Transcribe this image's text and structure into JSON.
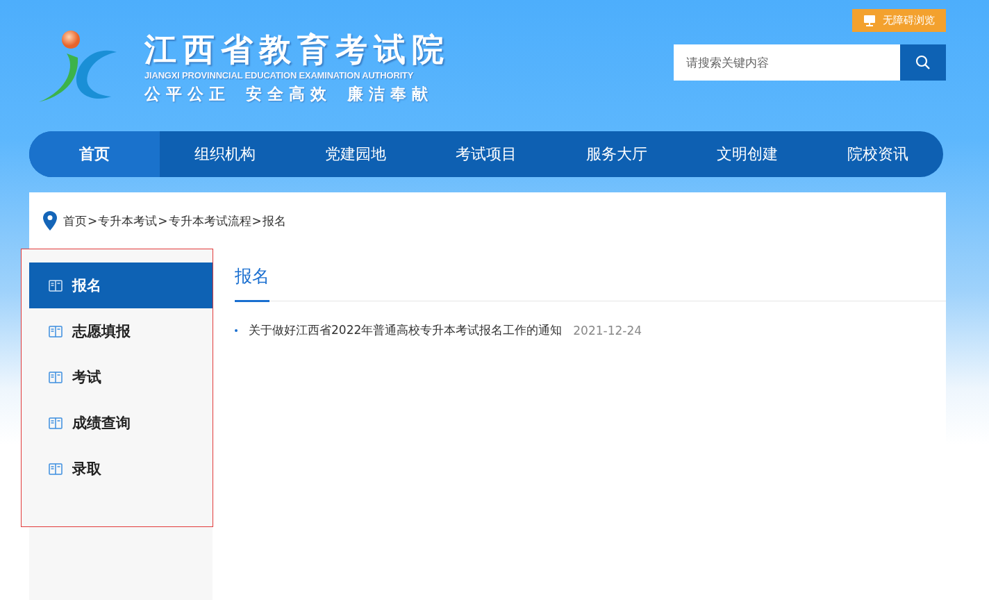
{
  "header": {
    "title": "江西省教育考试院",
    "subtitle": "JIANGXI PROVINNCIAL EDUCATION EXAMINATION AUTHORITY",
    "mottos": [
      "公平公正",
      "安全高效",
      "廉洁奉献"
    ],
    "accessibility_button": "无障碍浏览",
    "search": {
      "placeholder": "请搜索关键内容"
    }
  },
  "nav": [
    {
      "label": "首页",
      "selected": true
    },
    {
      "label": "组织机构",
      "selected": false
    },
    {
      "label": "党建园地",
      "selected": false
    },
    {
      "label": "考试项目",
      "selected": false
    },
    {
      "label": "服务大厅",
      "selected": false
    },
    {
      "label": "文明创建",
      "selected": false
    },
    {
      "label": "院校资讯",
      "selected": false
    }
  ],
  "breadcrumb": {
    "separator": ">",
    "items": [
      "首页",
      "专升本考试",
      "专升本考试流程",
      "报名"
    ]
  },
  "sidebar": [
    {
      "label": "报名",
      "selected": true
    },
    {
      "label": "志愿填报",
      "selected": false
    },
    {
      "label": "考试",
      "selected": false
    },
    {
      "label": "成绩查询",
      "selected": false
    },
    {
      "label": "录取",
      "selected": false
    }
  ],
  "section_title": "报名",
  "articles": [
    {
      "title": "关于做好江西省2022年普通高校专升本考试报名工作的通知",
      "date": "2021-12-24"
    }
  ]
}
